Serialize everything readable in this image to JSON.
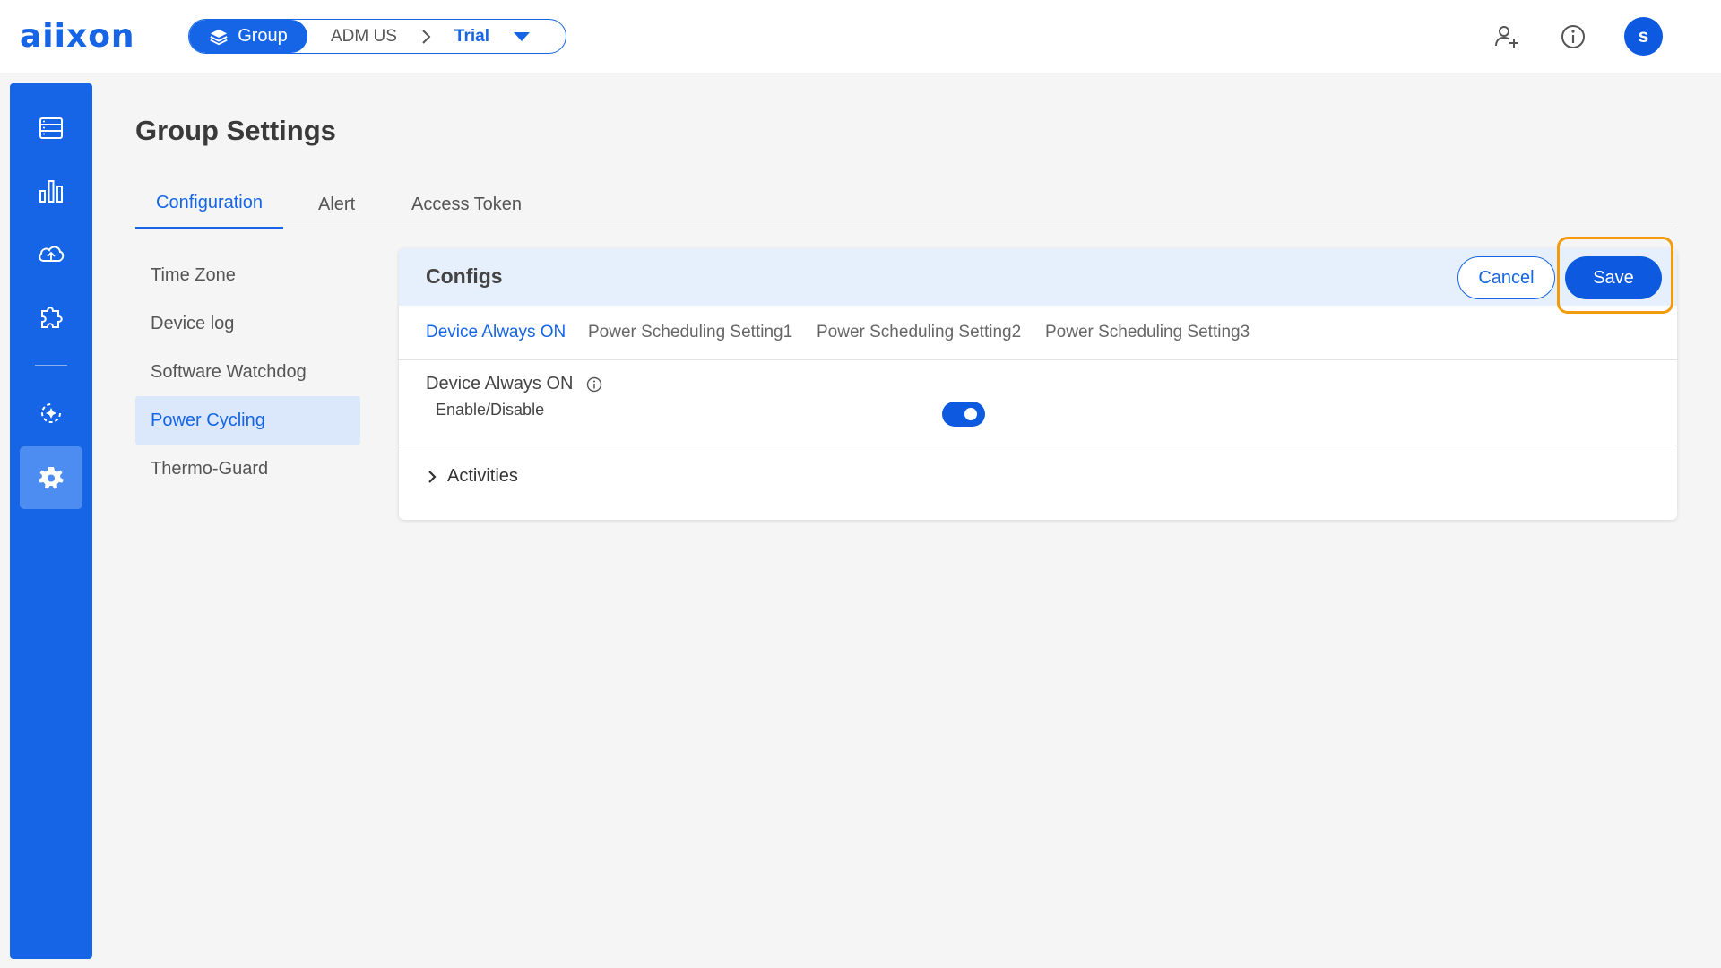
{
  "app": {
    "logo_text": "aiixon"
  },
  "breadcrumb": {
    "group_label": "Group",
    "org": "ADM US",
    "project": "Trial"
  },
  "header": {
    "avatar_initial": "s"
  },
  "page": {
    "title": "Group Settings"
  },
  "tabs": [
    {
      "label": "Configuration",
      "active": true
    },
    {
      "label": "Alert",
      "active": false
    },
    {
      "label": "Access Token",
      "active": false
    }
  ],
  "subnav": [
    {
      "label": "Time Zone",
      "active": false
    },
    {
      "label": "Device log",
      "active": false
    },
    {
      "label": "Software Watchdog",
      "active": false
    },
    {
      "label": "Power Cycling",
      "active": true
    },
    {
      "label": "Thermo-Guard",
      "active": false
    }
  ],
  "configs": {
    "title": "Configs",
    "cancel_label": "Cancel",
    "save_label": "Save",
    "tabs": [
      {
        "label": "Device Always ON",
        "active": true
      },
      {
        "label": "Power Scheduling Setting1",
        "active": false
      },
      {
        "label": "Power Scheduling Setting2",
        "active": false
      },
      {
        "label": "Power Scheduling Setting3",
        "active": false
      }
    ],
    "setting_label": "Device Always ON",
    "setting_sub": "Enable/Disable",
    "toggle_on": true,
    "activities_label": "Activities"
  },
  "colors": {
    "primary": "#1565e6",
    "highlight": "#f29b0c",
    "subnav_active_bg": "#dbe8fb"
  }
}
